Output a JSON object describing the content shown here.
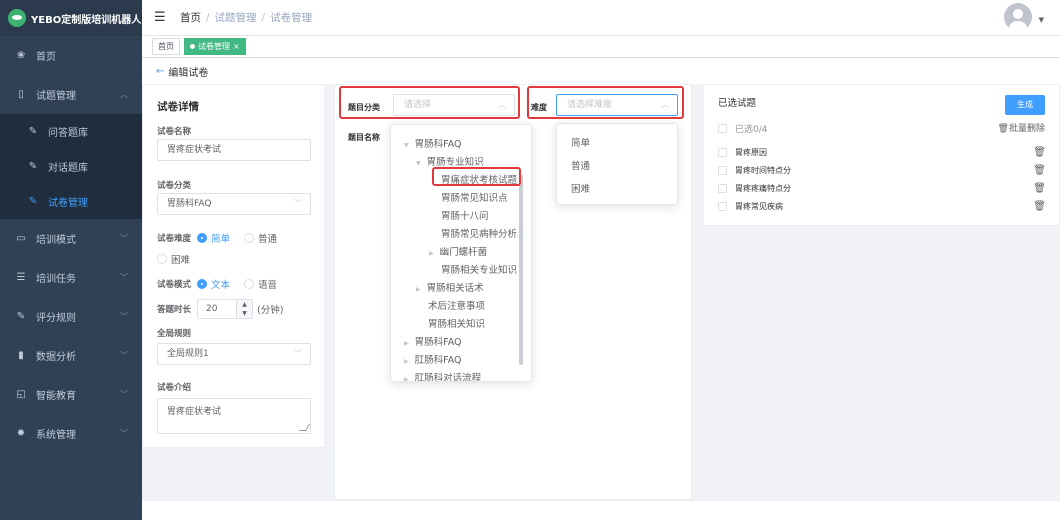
{
  "app": {
    "name": "YEBO定制版培训机器人"
  },
  "sidebar": {
    "items": [
      {
        "label": "首页",
        "icon": "dashboard-icon"
      },
      {
        "label": "试题管理",
        "icon": "book-icon"
      },
      {
        "label": "培训模式",
        "icon": "monitor-icon"
      },
      {
        "label": "培训任务",
        "icon": "list-icon"
      },
      {
        "label": "评分规则",
        "icon": "edit-icon"
      },
      {
        "label": "数据分析",
        "icon": "bar-chart-icon"
      },
      {
        "label": "智能教育",
        "icon": "education-icon"
      },
      {
        "label": "系统管理",
        "icon": "gear-icon"
      }
    ],
    "subitems": [
      {
        "label": "问答题库"
      },
      {
        "label": "对话题库"
      },
      {
        "label": "试卷管理"
      }
    ]
  },
  "breadcrumb": {
    "home": "首页",
    "level1": "试题管理",
    "level2": "试卷管理"
  },
  "tags": {
    "home": "首页",
    "active": "试卷管理"
  },
  "back": {
    "label": "编辑试卷"
  },
  "details": {
    "title": "试卷详情",
    "name_label": "试卷名称",
    "name_value": "胃疼症状考试",
    "category_label": "试卷分类",
    "category_value": "胃肠科FAQ",
    "difficulty_label": "试卷难度",
    "difficulty_options": [
      "简单",
      "普通",
      "困难"
    ],
    "mode_label": "试卷模式",
    "mode_options": [
      "文本",
      "语音"
    ],
    "duration_label": "答题时长",
    "duration_value": "20",
    "duration_unit": "(分钟)",
    "rule_label": "全局规则",
    "rule_value": "全局规则1",
    "intro_label": "试卷介绍",
    "intro_value": "胃疼症状考试"
  },
  "filter": {
    "category_label": "题目分类",
    "category_placeholder": "请选择",
    "difficulty_label": "难度",
    "difficulty_placeholder": "请选择难度",
    "name_label": "题目名称"
  },
  "tree": [
    "胃肠科FAQ",
    "胃肠专业知识",
    "胃痛症状考核试题",
    "胃肠常见知识点",
    "胃肠十八问",
    "胃肠常见病种分析",
    "幽门螺杆菌",
    "胃肠相关专业知识",
    "胃肠相关话术",
    "术后注意事项",
    "胃肠相关知识",
    "胃肠科FAQ",
    "肛肠科FAQ",
    "肛肠科对话流程"
  ],
  "difficulty_dropdown": [
    "简单",
    "普通",
    "困难"
  ],
  "selected": {
    "title": "已选试题",
    "generate": "生成",
    "count_label": "已选0/4",
    "batch_delete": "批量删除",
    "questions": [
      "胃疼原因",
      "胃疼时间特点分",
      "胃疼疼痛特点分",
      "胃疼常见疾病"
    ]
  }
}
